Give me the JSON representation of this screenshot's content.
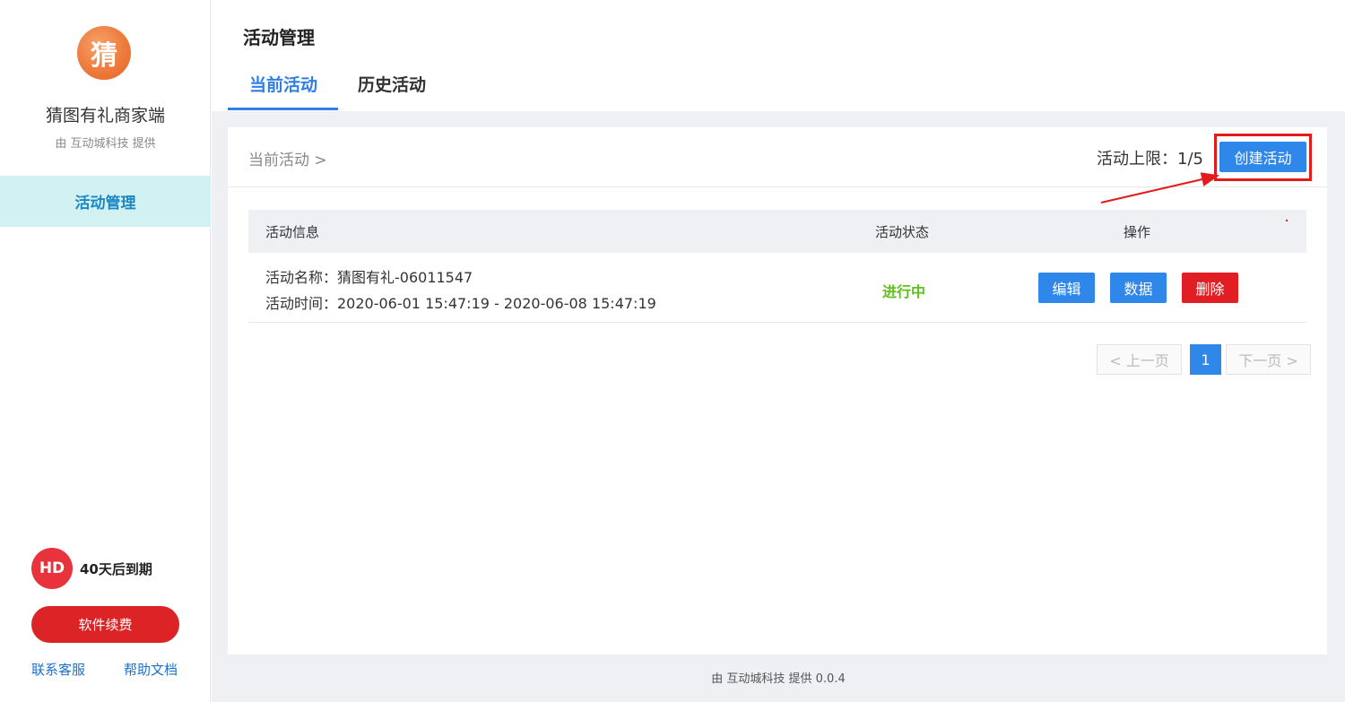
{
  "sidebar": {
    "logo_char": "猜",
    "app_name": "猜图有礼商家端",
    "provider": "由 互动城科技 提供",
    "nav_items": [
      {
        "label": "活动管理"
      }
    ],
    "brand_badge": "HD",
    "expire_text": "40天后到期",
    "renew_label": "软件续费",
    "contact_label": "联系客服",
    "help_label": "帮助文档"
  },
  "header": {
    "title": "活动管理",
    "tabs": [
      {
        "label": "当前活动",
        "active": true
      },
      {
        "label": "历史活动",
        "active": false
      }
    ]
  },
  "main": {
    "breadcrumb": "当前活动 >",
    "limit_text": "活动上限：1/5",
    "create_label": "创建活动",
    "table": {
      "headers": [
        "活动信息",
        "活动状态",
        "操作"
      ],
      "rows": [
        {
          "name": "活动名称：猜图有礼-06011547",
          "time": "活动时间：2020-06-01 15:47:19 - 2020-06-08 15:47:19",
          "status": "进行中",
          "actions": [
            "编辑",
            "数据",
            "删除"
          ]
        }
      ]
    },
    "pagination": {
      "prev": "< 上一页",
      "current": "1",
      "next": "下一页 >"
    }
  },
  "footer": {
    "text": "由 互动城科技 提供 0.0.4"
  },
  "colors": {
    "accent": "#2f87ea",
    "danger": "#e01e24",
    "success": "#5fc21b",
    "nav_active_bg": "#d2f1f2"
  }
}
